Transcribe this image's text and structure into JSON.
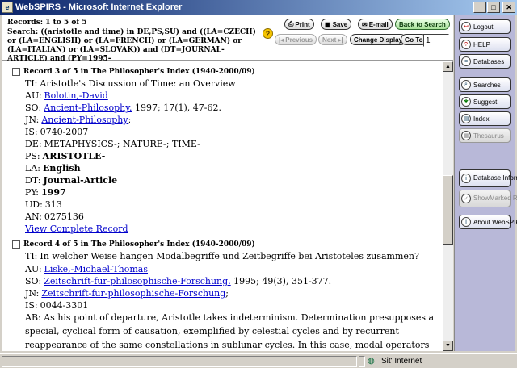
{
  "window": {
    "title": "WebSPIRS - Microsoft Internet Explorer",
    "min_glyph": "_",
    "max_glyph": "□",
    "close_glyph": "✕",
    "icon_name": "ie-icon"
  },
  "header": {
    "records_label": "Records: 1 to 5 of 5",
    "search_query": "Search: ((aristotle and time) in DE,PS,SU) and ((LA=CZECH) or (LA=ENGLISH) or (LA=FRENCH) or (LA=GERMAN) or (LA=ITALIAN) or (LA=SLOVAK)) and (DT=JOURNAL-ARTICLE) and (PY=1995-",
    "hint_glyph": "?",
    "buttons": {
      "print": "Print",
      "save": "Save",
      "email": "E-mail",
      "back": "Back to Search",
      "previous": "Previous",
      "next": "Next",
      "change_display": "Change Display",
      "goto": "Go To"
    },
    "goto_value": "1"
  },
  "records": [
    {
      "heading": "Record 3 of 5 in The Philosopher's Index (1940-2000/09)",
      "ti_label": "TI:",
      "ti": "Aristotle's Discussion of Time: an Overview",
      "au_label": "AU:",
      "au": "Bolotin,-David",
      "so_label": "SO:",
      "so_link": "Ancient-Philosophy.",
      "so_rest": " 1997; 17(1), 47-62.",
      "jn_label": "JN:",
      "jn_link": "Ancient-Philosophy",
      "jn_rest": ";",
      "is_label": "IS:",
      "is": "0740-2007",
      "de_label": "DE:",
      "de": "METAPHYSICS-; NATURE-; TIME-",
      "ps_label": "PS:",
      "ps": "ARISTOTLE-",
      "la_label": "LA:",
      "la": "English",
      "dt_label": "DT:",
      "dt": "Journal-Article",
      "py_label": "PY:",
      "py": "1997",
      "ud_label": "UD:",
      "ud": "313",
      "an_label": "AN:",
      "an": "0275136",
      "view_complete": "View Complete Record"
    },
    {
      "heading": "Record 4 of 5 in The Philosopher's Index (1940-2000/09)",
      "ti_label": "TI:",
      "ti": "In welcher Weise hangen Modalbegriffe und Zeitbegriffe bei Aristoteles zusammen?",
      "au_label": "AU:",
      "au": "Liske,-Michael-Thomas",
      "so_label": "SO:",
      "so_link": "Zeitschrift-fur-philosophische-Forschung.",
      "so_rest": " 1995; 49(3), 351-377.",
      "jn_label": "JN:",
      "jn_link": "Zeitschrift-fur-philosophische-Forschung",
      "jn_rest": ";",
      "is_label": "IS:",
      "is": "0044-3301",
      "ab_label": "AB:",
      "ab": "As his point of departure, Aristotle takes indeterminism. Determination presupposes a special, cyclical form of causation, exemplified by celestial cycles and by recurrent reappearance of the same constellations in sublunar cycles. In this case, modal operators are to be interpreted extensionally on the basis of the"
    }
  ],
  "sidebar": {
    "logout": "Logout",
    "help": "HELP",
    "databases": "Databases",
    "searches": "Searches",
    "suggest": "Suggest",
    "index": "Index",
    "thesaurus": "Thesaurus",
    "db_info": "Database Information",
    "show_marked": "ShowMarked Records",
    "about": "About WebSPIRS"
  },
  "status": {
    "zone": "Sit' Internet"
  }
}
